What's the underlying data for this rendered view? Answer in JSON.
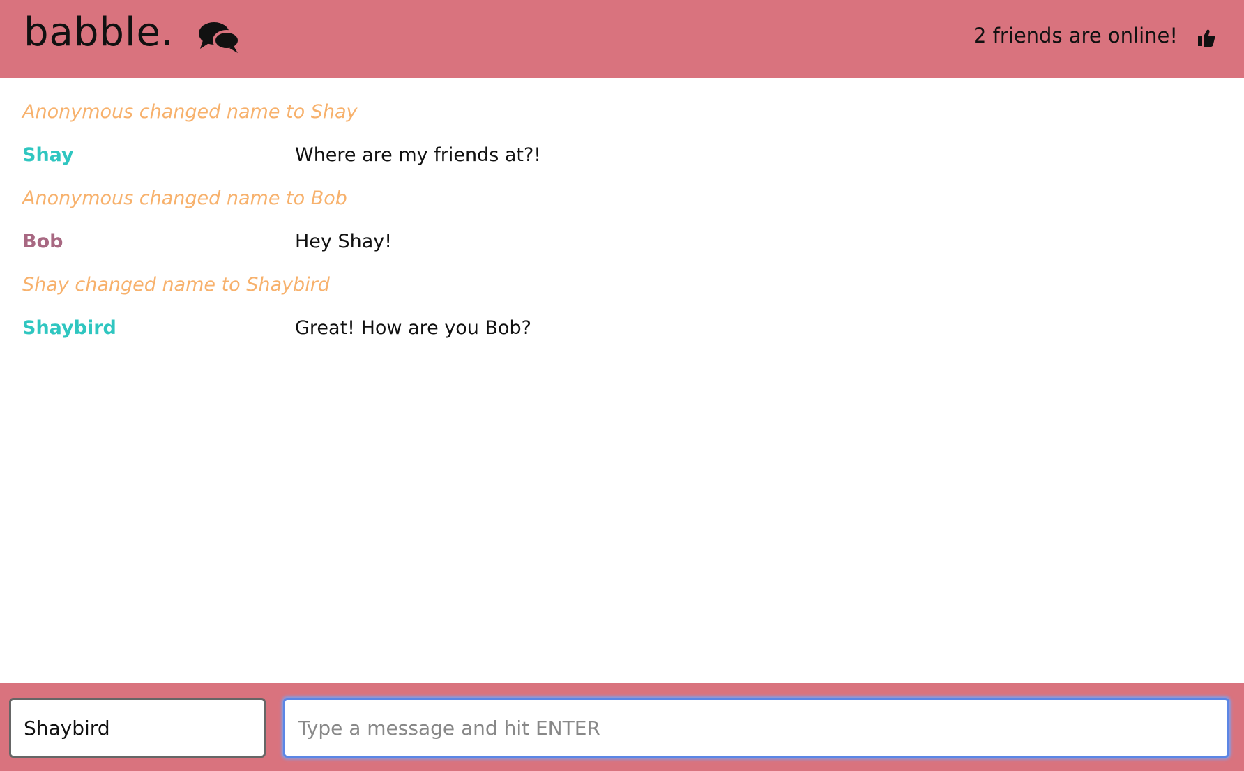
{
  "header": {
    "brand": "babble.",
    "online_status": "2 friends are online!",
    "chat_icon": "chat-bubbles-icon",
    "status_icon": "thumbs-up-icon"
  },
  "messages": [
    {
      "type": "system",
      "text": "Anonymous changed name to Shay"
    },
    {
      "type": "user",
      "user": "Shay",
      "text": "Where are my friends at?!",
      "color": "#2fc6c0"
    },
    {
      "type": "system",
      "text": "Anonymous changed name to Bob"
    },
    {
      "type": "user",
      "user": "Bob",
      "text": "Hey Shay!",
      "color": "#a86882"
    },
    {
      "type": "system",
      "text": "Shay changed name to Shaybird"
    },
    {
      "type": "user",
      "user": "Shaybird",
      "text": "Great! How are you Bob?",
      "color": "#2fc6c0"
    }
  ],
  "footer": {
    "name_value": "Shaybird",
    "message_placeholder": "Type a message and hit ENTER",
    "message_value": ""
  },
  "colors": {
    "accent": "#d9737e",
    "system_text": "#f7b16c"
  }
}
